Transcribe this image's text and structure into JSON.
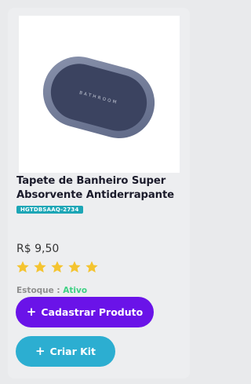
{
  "product": {
    "title": "Tapete de Banheiro Super Absorvente Antiderrapante",
    "sku": "HGTDBSAAQ-2734",
    "price": "R$ 9,50",
    "rating_stars": 5,
    "stock_label": "Estoque :",
    "stock_value": "Ativo",
    "image_text": "BATHROOM"
  },
  "actions": {
    "register_label": "Cadastrar Produto",
    "kit_label": "Criar Kit",
    "icon": "plus-icon"
  },
  "colors": {
    "primary_button": "#6a13e8",
    "secondary_button": "#2caed1",
    "sku_badge": "#1ca6b6",
    "star": "#f4c430",
    "stock_active": "#3ed184"
  }
}
